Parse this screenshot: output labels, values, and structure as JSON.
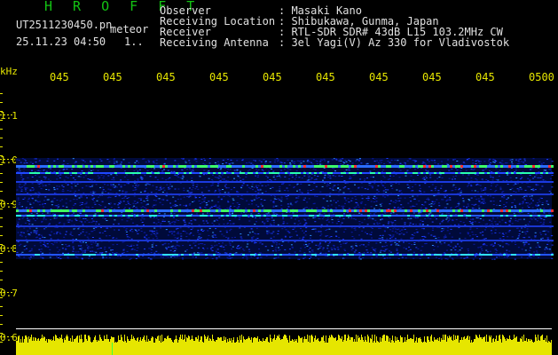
{
  "header": {
    "brand": "H R O F F T",
    "filename": "UT2511230450.pn",
    "type": "meteor",
    "datetime": "25.11.23 04:50",
    "flag": "1..",
    "fields": [
      {
        "label": "Observer",
        "value": ": Masaki Kano"
      },
      {
        "label": "Receiving Location",
        "value": ": Shibukawa, Gunma, Japan"
      },
      {
        "label": "Receiver",
        "value": ": RTL-SDR SDR# 43dB L15 103.2MHz CW"
      },
      {
        "label": "Receiving Antenna",
        "value": ": 3el Yagi(V) Az 330 for Vladivostok"
      }
    ]
  },
  "time_axis": {
    "ticks": [
      "045",
      "045",
      "045",
      "045",
      "045",
      "045",
      "045",
      "045",
      "045",
      "0500"
    ]
  },
  "freq_axis": {
    "unit": "kHz",
    "ticks": [
      "1.1",
      "1.0",
      "0.9",
      "0.8",
      "0.7",
      "0.6"
    ]
  },
  "colors": {
    "brand": "#13c313",
    "axis_labels": "#e6e600",
    "header_text": "#e0e0e0",
    "background": "#000000",
    "noise_band": "#ffff00"
  }
}
